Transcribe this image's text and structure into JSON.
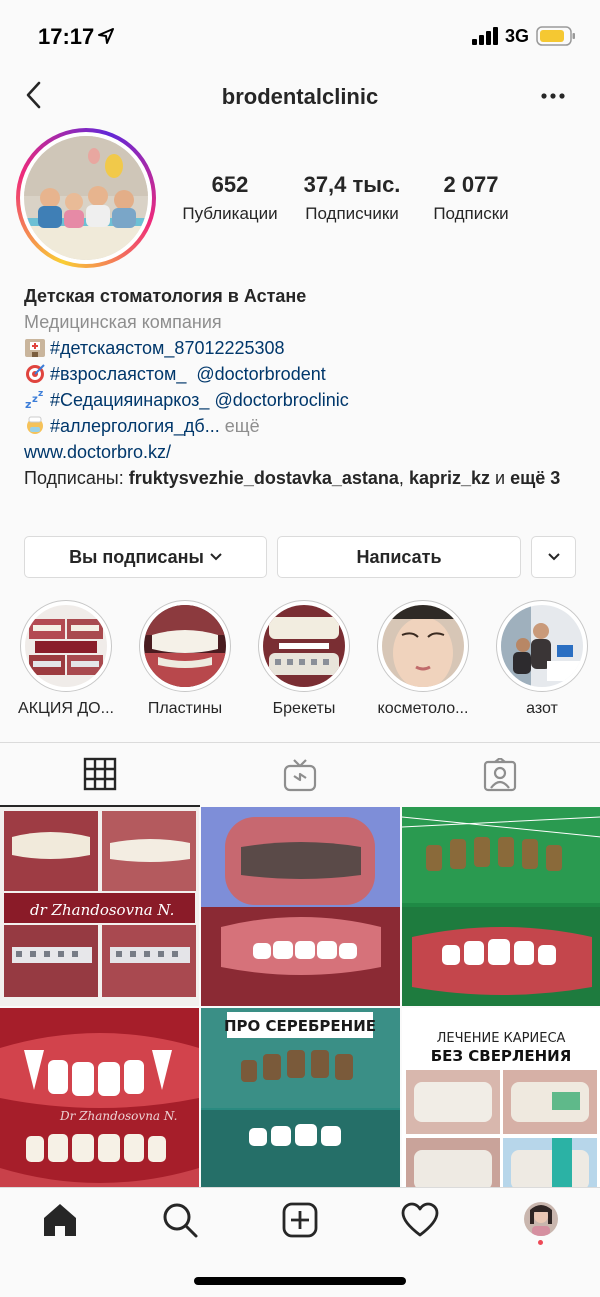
{
  "status_bar": {
    "time": "17:17",
    "network": "3G"
  },
  "header": {
    "title": "brodentalclinic"
  },
  "stats": [
    {
      "value": "652",
      "label": "Публикации"
    },
    {
      "value": "37,4 тыс.",
      "label": "Подписчики"
    },
    {
      "value": "2 077",
      "label": "Подписки"
    }
  ],
  "bio": {
    "name": "Детская стоматология в Астане",
    "category": "Медицинская компания",
    "line1": "#детскаястом_87012225308",
    "line2_tag": "#взрослаястом_",
    "line2_mention": "@doctorbrodent",
    "line3_tag": "#Седацияинаркоз_",
    "line3_mention": "@doctorbroclinic",
    "line4_tag": "#аллергология_дб...",
    "line4_more": "ещё",
    "link": "www.doctorbro.kz/",
    "followed_prefix": "Подписаны:",
    "followed_user1": "fruktysvezhie_dostavka_astana",
    "followed_sep": ",",
    "followed_user2": "kapriz_kz",
    "followed_and": "и",
    "followed_more": "ещё 3"
  },
  "buttons": {
    "following": "Вы подписаны",
    "message": "Написать"
  },
  "highlights": [
    {
      "label": "АКЦИЯ ДО..."
    },
    {
      "label": "Пластины"
    },
    {
      "label": "Брекеты"
    },
    {
      "label": "косметоло..."
    },
    {
      "label": "азот"
    }
  ],
  "grid": {
    "post1_caption": "dr Zhandosovna N.",
    "post4_caption": "Dr Zhandosovna N.",
    "post5_caption": "ПРО СЕРЕБРЕНИЕ",
    "post6_caption_1": "ЛЕЧЕНИЕ КАРИЕСА",
    "post6_caption_2": "БЕЗ СВЕРЛЕНИЯ"
  },
  "icons": {
    "back": "chevron-left-icon",
    "more": "more-horizontal-icon",
    "grid_tab": "grid-icon",
    "igtv_tab": "igtv-icon",
    "tagged_tab": "tagged-user-icon",
    "home": "home-icon",
    "search": "search-icon",
    "add": "add-post-icon",
    "activity": "heart-icon"
  },
  "colors": {
    "link": "#00376b",
    "secondary": "#8e8e8e",
    "notification_dot": "#ed4956"
  }
}
